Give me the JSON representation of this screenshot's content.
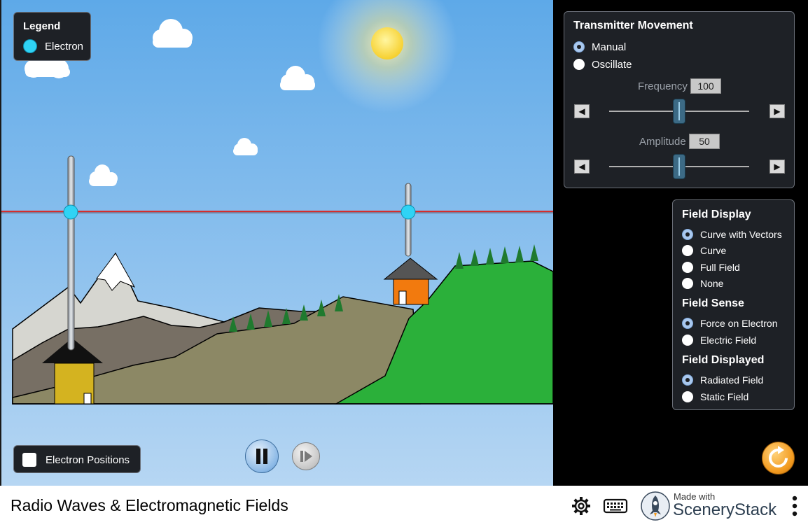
{
  "legend": {
    "title": "Legend",
    "electron_label": "Electron"
  },
  "transmitter": {
    "title": "Transmitter Movement",
    "options": [
      {
        "label": "Manual",
        "checked": true
      },
      {
        "label": "Oscillate",
        "checked": false
      }
    ],
    "frequency": {
      "label": "Frequency",
      "value": "100"
    },
    "amplitude": {
      "label": "Amplitude",
      "value": "50"
    }
  },
  "field_panel": {
    "display_title": "Field Display",
    "display_options": [
      {
        "label": "Curve with Vectors",
        "checked": true
      },
      {
        "label": "Curve",
        "checked": false
      },
      {
        "label": "Full Field",
        "checked": false
      },
      {
        "label": "None",
        "checked": false
      }
    ],
    "sense_title": "Field Sense",
    "sense_options": [
      {
        "label": "Force on Electron",
        "checked": true
      },
      {
        "label": "Electric Field",
        "checked": false
      }
    ],
    "displayed_title": "Field Displayed",
    "displayed_options": [
      {
        "label": "Radiated Field",
        "checked": true
      },
      {
        "label": "Static Field",
        "checked": false
      }
    ]
  },
  "electron_positions": {
    "label": "Electron Positions",
    "checked": false
  },
  "footer": {
    "title": "Radio Waves & Electromagnetic Fields",
    "made_with": "Made with",
    "brand": "SceneryStack"
  },
  "colors": {
    "electron": "#2fd3f5",
    "panel_bg": "#1e2126",
    "sky_top": "#5ea9e8",
    "sky_bottom": "#b6d6f3",
    "hill_green": "#2bb03a",
    "reset_orange": "#f29a1f"
  },
  "icons": {
    "pause": "pause-icon",
    "step": "step-forward-icon",
    "reset": "reset-icon",
    "settings": "gear-icon",
    "keyboard": "keyboard-icon",
    "menu": "kebab-menu-icon"
  }
}
